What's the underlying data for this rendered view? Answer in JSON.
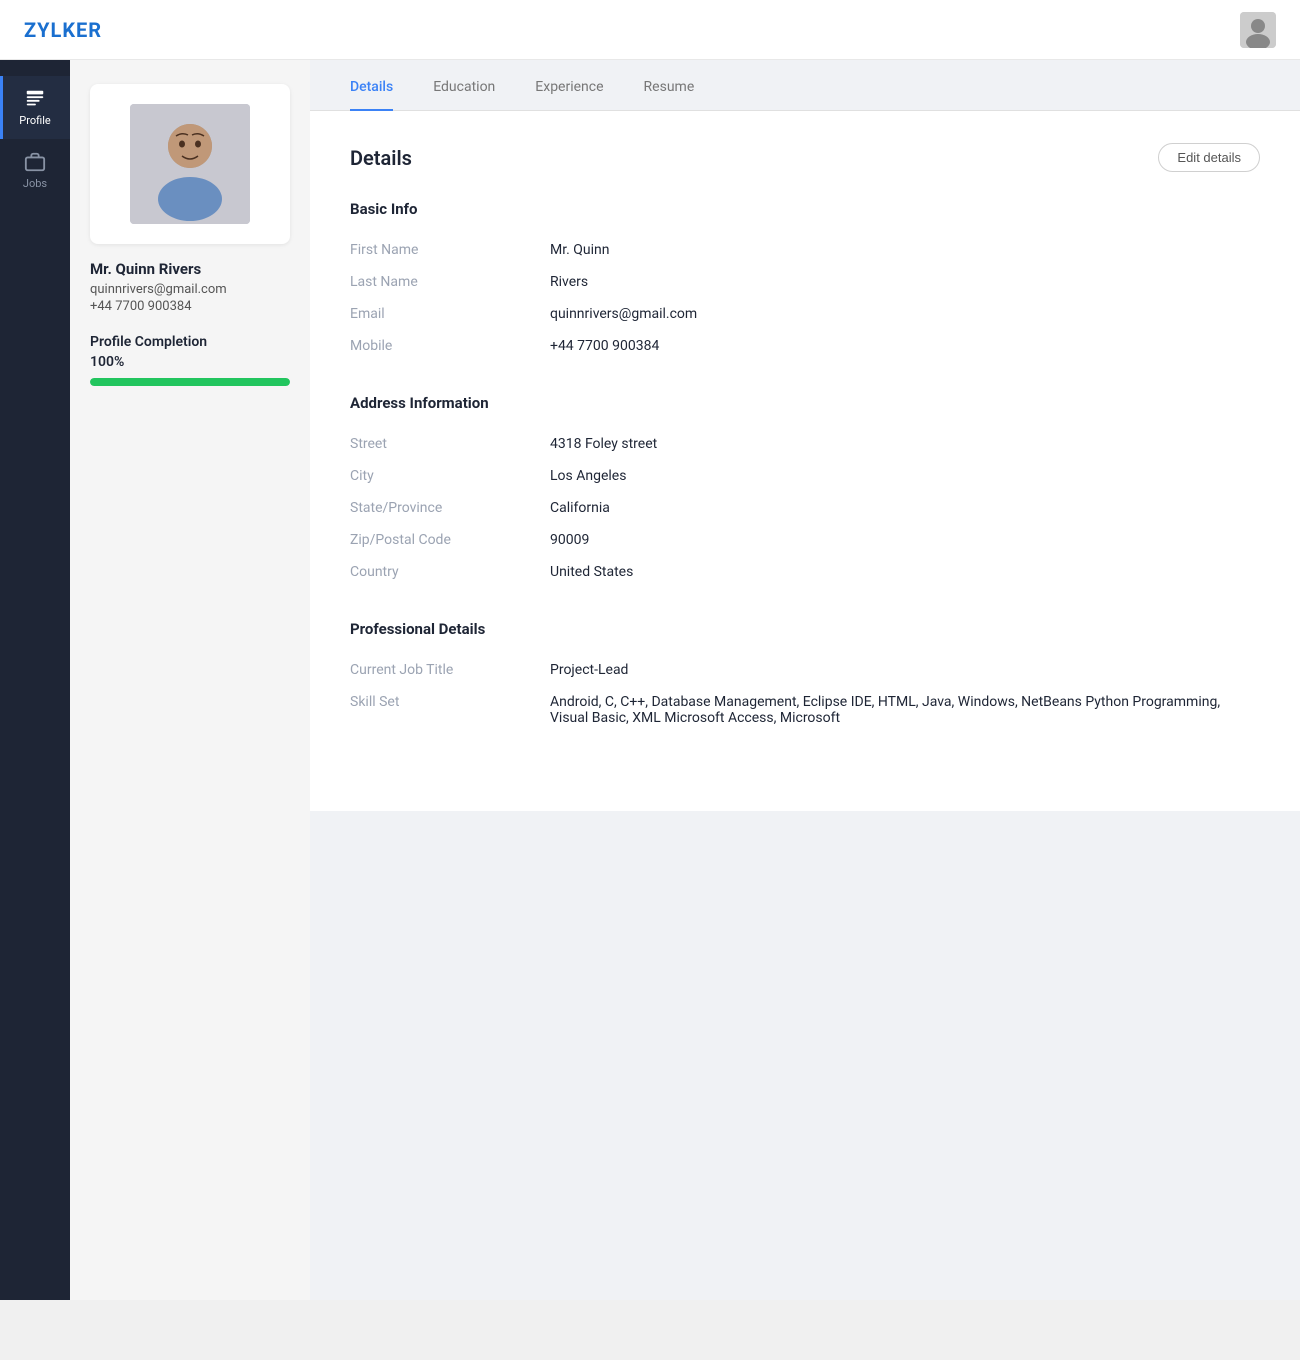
{
  "topbar": {
    "logo": "ZYLKER"
  },
  "sidebar": {
    "items": [
      {
        "id": "profile",
        "label": "Profile",
        "active": true
      },
      {
        "id": "jobs",
        "label": "Jobs",
        "active": false
      }
    ]
  },
  "leftPanel": {
    "profileName": "Mr. Quinn Rivers",
    "profileEmail": "quinnrivers@gmail.com",
    "profilePhone": "+44 7700 900384",
    "completion": {
      "label": "Profile Completion",
      "percent": "100%",
      "value": 100
    }
  },
  "tabs": [
    {
      "id": "details",
      "label": "Details",
      "active": true
    },
    {
      "id": "education",
      "label": "Education",
      "active": false
    },
    {
      "id": "experience",
      "label": "Experience",
      "active": false
    },
    {
      "id": "resume",
      "label": "Resume",
      "active": false
    }
  ],
  "detailsCard": {
    "title": "Details",
    "editButton": "Edit details",
    "sections": [
      {
        "id": "basic-info",
        "title": "Basic Info",
        "rows": [
          {
            "label": "First Name",
            "value": "Mr.   Quinn"
          },
          {
            "label": "Last Name",
            "value": "Rivers"
          },
          {
            "label": "Email",
            "value": "quinnrivers@gmail.com"
          },
          {
            "label": "Mobile",
            "value": "+44 7700 900384"
          }
        ]
      },
      {
        "id": "address",
        "title": "Address Information",
        "rows": [
          {
            "label": "Street",
            "value": "4318 Foley street"
          },
          {
            "label": "City",
            "value": "Los Angeles"
          },
          {
            "label": "State/Province",
            "value": "California"
          },
          {
            "label": "Zip/Postal Code",
            "value": "90009"
          },
          {
            "label": "Country",
            "value": "United States"
          }
        ]
      },
      {
        "id": "professional",
        "title": "Professional Details",
        "rows": [
          {
            "label": "Current Job Title",
            "value": "Project-Lead"
          },
          {
            "label": "Skill Set",
            "value": "Android, C, C++, Database Management, Eclipse IDE, HTML, Java, Windows, NetBeans Python Programming, Visual Basic, XML Microsoft Access, Microsoft"
          }
        ]
      }
    ]
  }
}
